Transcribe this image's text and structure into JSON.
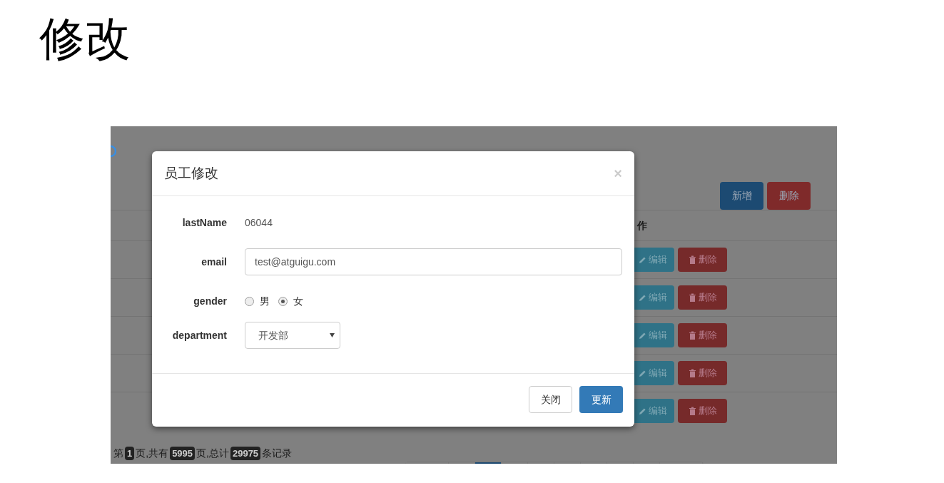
{
  "slide": {
    "title": "修改"
  },
  "page": {
    "toolbar": [
      {
        "label": "新增",
        "kind": "primary"
      },
      {
        "label": "删除",
        "kind": "danger"
      }
    ],
    "table": {
      "columns": [
        "作"
      ],
      "rows": [
        {
          "actions": [
            {
              "label": "编辑",
              "kind": "edit"
            },
            {
              "label": "删除",
              "kind": "delete"
            }
          ]
        },
        {
          "actions": [
            {
              "label": "编辑",
              "kind": "edit"
            },
            {
              "label": "删除",
              "kind": "delete"
            }
          ]
        },
        {
          "actions": [
            {
              "label": "编辑",
              "kind": "edit"
            },
            {
              "label": "删除",
              "kind": "delete"
            }
          ]
        },
        {
          "actions": [
            {
              "label": "编辑",
              "kind": "edit"
            },
            {
              "label": "删除",
              "kind": "delete"
            }
          ]
        },
        {
          "actions": [
            {
              "label": "编辑",
              "kind": "edit"
            },
            {
              "label": "删除",
              "kind": "delete"
            }
          ]
        }
      ]
    },
    "pagination_info": [
      {
        "text": "第",
        "kind": "text"
      },
      {
        "text": "1",
        "kind": "badge"
      },
      {
        "text": "页,共有",
        "kind": "text"
      },
      {
        "text": "5995",
        "kind": "badge"
      },
      {
        "text": "页,总计",
        "kind": "text"
      },
      {
        "text": "29975",
        "kind": "badge"
      },
      {
        "text": "条记录",
        "kind": "text"
      }
    ],
    "pagination": [
      {
        "kind": "wide",
        "selected": false
      },
      {
        "kind": "page",
        "selected": false
      },
      {
        "kind": "page",
        "selected": true
      },
      {
        "kind": "page",
        "selected": false
      },
      {
        "kind": "page",
        "selected": false
      },
      {
        "kind": "page",
        "selected": false
      },
      {
        "kind": "page",
        "selected": false
      },
      {
        "kind": "page",
        "selected": false
      },
      {
        "kind": "page",
        "selected": false
      },
      {
        "kind": "wide",
        "selected": false
      }
    ]
  },
  "modal": {
    "title": "员工修改",
    "close": "×",
    "fields": [
      {
        "label": "lastName",
        "kind": "static",
        "value": "06044"
      },
      {
        "label": "email",
        "kind": "input",
        "value": "test@atguigu.com"
      },
      {
        "label": "gender",
        "kind": "radio",
        "options": [
          {
            "label": "男",
            "selected": false
          },
          {
            "label": "女",
            "selected": true
          }
        ]
      },
      {
        "label": "department",
        "kind": "select",
        "value": "开发部"
      }
    ],
    "buttons": [
      {
        "label": "关闭",
        "kind": "default"
      },
      {
        "label": "更新",
        "kind": "primary"
      }
    ]
  }
}
